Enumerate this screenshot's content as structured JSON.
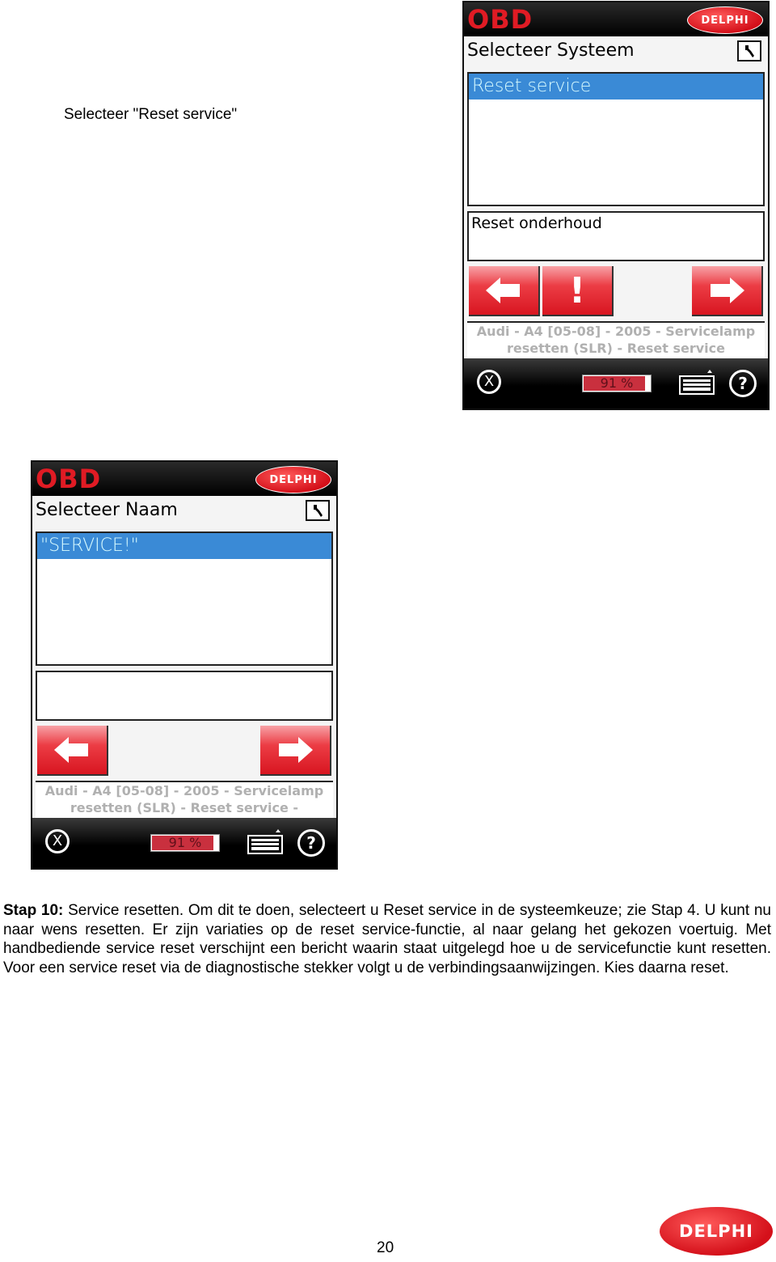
{
  "caption": "Selecteer \"Reset service\"",
  "device_system": {
    "brand": "OBD",
    "logo": "DELPHI",
    "title": "Selecteer Systeem",
    "tool_icon": "wrench-icon",
    "list_items": [
      "Reset service"
    ],
    "selected_index": 0,
    "description": "Reset onderhoud",
    "buttons": [
      "back-arrow",
      "warning",
      "next-arrow"
    ],
    "warning_label": "!",
    "info_line1": "Audi - A4 [05-08] - 2005 - Servicelamp",
    "info_line2": "resetten (SLR) - Reset service",
    "footer": {
      "close": "X",
      "progress_percent": 91,
      "progress_label": "91 %",
      "help": "?"
    }
  },
  "device_name": {
    "brand": "OBD",
    "logo": "DELPHI",
    "title": "Selecteer Naam",
    "tool_icon": "wrench-icon",
    "list_items": [
      "\"SERVICE!\""
    ],
    "selected_index": 0,
    "description": "",
    "buttons": [
      "back-arrow",
      "next-arrow"
    ],
    "info_line1": "Audi - A4 [05-08] - 2005 - Servicelamp",
    "info_line2": "resetten (SLR) - Reset service -",
    "footer": {
      "close": "X",
      "progress_percent": 91,
      "progress_label": "91 %",
      "help": "?"
    }
  },
  "paragraph": {
    "lead": "Stap 10:",
    "text": " Service resetten. Om dit te doen, selecteert u Reset service in de systeemkeuze; zie Stap 4. U kunt nu naar wens resetten. Er zijn variaties op de reset service-functie, al naar gelang het gekozen voertuig.  Met handbediende service reset verschijnt een bericht waarin staat uitgelegd hoe u de servicefunctie kunt resetten. Voor een service reset via de diagnostische stekker volgt u de verbindingsaanwijzingen. Kies daarna reset."
  },
  "page_number": "20",
  "footer_logo": "DELPHI"
}
